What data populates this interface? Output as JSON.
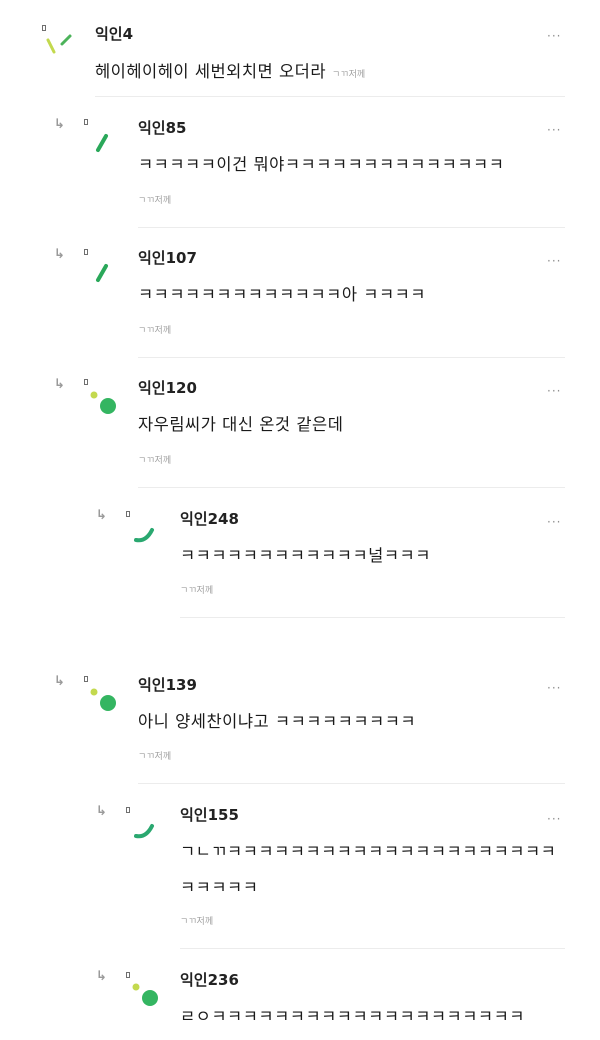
{
  "more_label": "···",
  "comments": [
    {
      "nick": "익인4",
      "text": "헤이헤이헤이 세번외치면 오더라",
      "tag": "ㄱㄲ저께"
    },
    {
      "nick": "익인85",
      "text": "ㅋㅋㅋㅋㅋ이건 뭐야ㅋㅋㅋㅋㅋㅋㅋㅋㅋㅋㅋㅋㅋㅋ",
      "tag": "ㄱㄲ저께"
    },
    {
      "nick": "익인107",
      "text": "ㅋㅋㅋㅋㅋㅋㅋㅋㅋㅋㅋㅋㅋ아 ㅋㅋㅋㅋ",
      "tag": "ㄱㄲ저께"
    },
    {
      "nick": "익인120",
      "text": "자우림씨가 대신 온것 같은데",
      "tag": "ㄱㄲ저께"
    },
    {
      "nick": "익인248",
      "text": "ㅋㅋㅋㅋㅋㅋㅋㅋㅋㅋㅋㅋ널ㅋㅋㅋ",
      "tag": "ㄱㄲ저께"
    },
    {
      "nick": "익인139",
      "text": "아니 양세찬이냐고 ㅋㅋㅋㅋㅋㅋㅋㅋㅋ",
      "tag": "ㄱㄲ저께"
    },
    {
      "nick": "익인155",
      "text": "ㄱㄴㄲㅋㅋㅋㅋㅋㅋㅋㅋㅋㅋㅋㅋㅋㅋㅋㅋㅋㅋㅋㅋㅋ",
      "text2": "ㅋㅋㅋㅋㅋ",
      "tag": "ㄱㄲ저께"
    },
    {
      "nick": "익인236",
      "text": "ㄹㅇㅋㅋㅋㅋㅋㅋㅋㅋㅋㅋㅋㅋㅋㅋㅋㅋㅋㅋㅋㅋ"
    }
  ]
}
